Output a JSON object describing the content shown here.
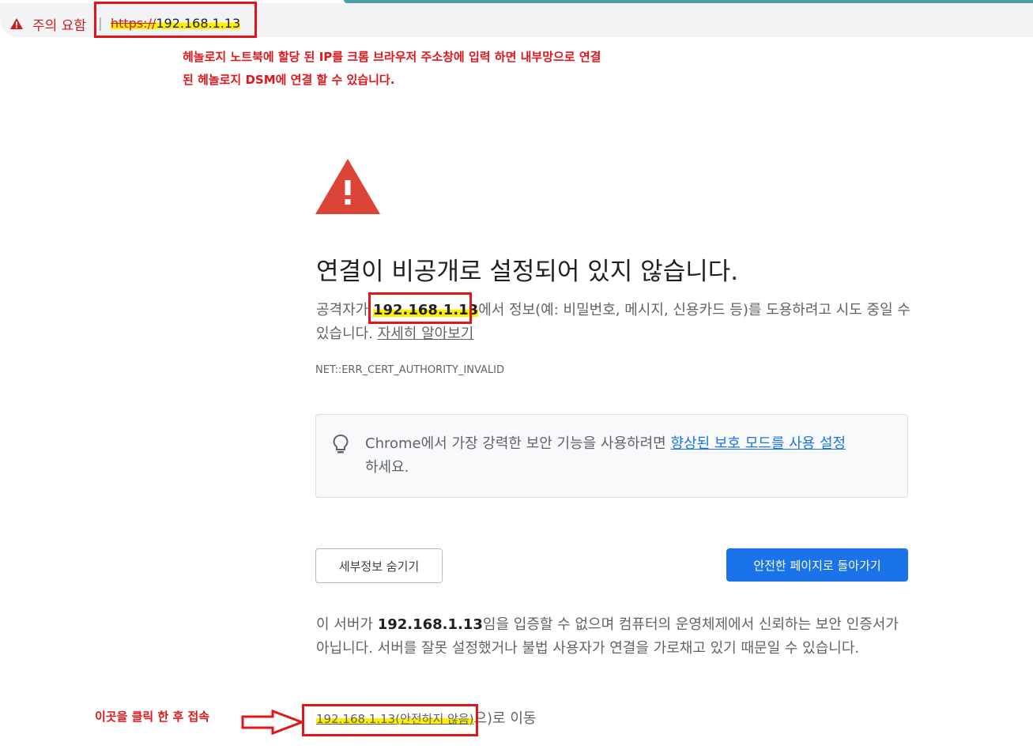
{
  "address_bar": {
    "warning_label": "주의 요함",
    "separator": "|",
    "url_scheme": "https://",
    "url_host": "192.168.1.13"
  },
  "annotations": {
    "top_note_line1": "헤놀로지 노트북에 할당 된 IP를 크롬 브라우저 주소창에 입력 하면 내부망으로 연결",
    "top_note_line2": "된 헤놀로지 DSM에 연결 할 수 있습니다.",
    "bottom_note": "이곳을 클릭 한 후 접속"
  },
  "interstitial": {
    "title": "연결이 비공개로 설정되어 있지 않습니다.",
    "desc_prefix": "공격자가 ",
    "desc_host": "192.168.1.13",
    "desc_suffix": "에서 정보(예: 비밀번호, 메시지, 신용카드 등)를 도용하려고 시도 중일 수 있습니다. ",
    "learn_more": "자세히 알아보기",
    "error_code": "NET::ERR_CERT_AUTHORITY_INVALID",
    "tip_prefix": "Chrome에서 가장 강력한 보안 기능을 사용하려면 ",
    "tip_link": "향상된 보호 모드를 사용 설정",
    "tip_suffix": "하세요.",
    "hide_details_button": "세부정보 숨기기",
    "back_button": "안전한 페이지로 돌아가기",
    "details_prefix": "이 서버가 ",
    "details_host": "192.168.1.13",
    "details_suffix": "임을 입증할 수 없으며 컴퓨터의 운영체제에서 신뢰하는 보안 인증서가 아닙니다. 서버를 잘못 설정했거나 불법 사용자가 연결을 가로채고 있기 때문일 수 있습니다.",
    "proceed_link": "192.168.1.13(안전하지 않음)",
    "proceed_suffix": "으)로 이동"
  },
  "colors": {
    "annotation_red": "#e0161b",
    "highlight_yellow": "#ffee00",
    "primary_blue": "#1a73e8",
    "warning_red": "#db4437"
  }
}
